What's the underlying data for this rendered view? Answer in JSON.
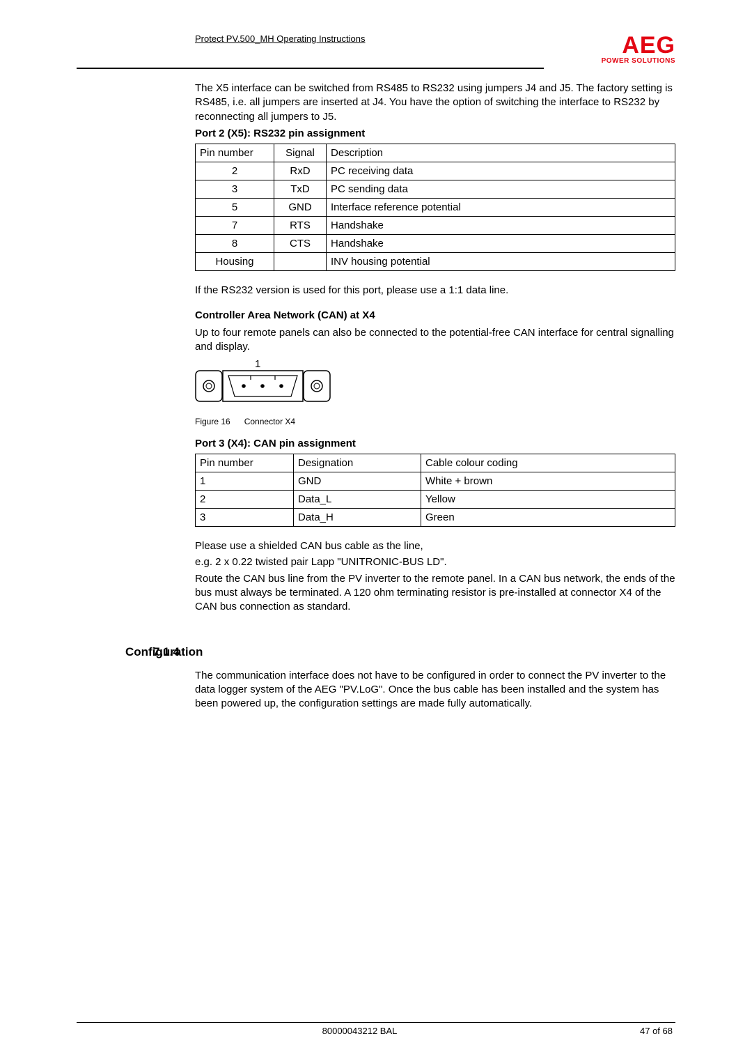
{
  "header": {
    "doc_title": "Protect PV.500_MH Operating Instructions",
    "logo_main": "AEG",
    "logo_sub": "POWER SOLUTIONS"
  },
  "intro_paragraph": "The X5 interface can be switched from RS485 to RS232 using jumpers J4 and J5. The factory setting is RS485, i.e. all jumpers are inserted at J4. You have the option of switching the interface to RS232 by reconnecting all jumpers to J5.",
  "port2": {
    "heading": "Port 2 (X5): RS232 pin assignment",
    "cols": [
      "Pin number",
      "Signal",
      "Description"
    ],
    "rows": [
      {
        "pin": "2",
        "sig": "RxD",
        "desc": "PC receiving data"
      },
      {
        "pin": "3",
        "sig": "TxD",
        "desc": "PC sending data"
      },
      {
        "pin": "5",
        "sig": "GND",
        "desc": "Interface reference potential"
      },
      {
        "pin": "7",
        "sig": "RTS",
        "desc": "Handshake"
      },
      {
        "pin": "8",
        "sig": "CTS",
        "desc": "Handshake"
      },
      {
        "pin": "Housing",
        "sig": "",
        "desc": "INV housing potential"
      }
    ]
  },
  "rs232_note": "If the RS232 version is used for this port, please use a 1:1 data line.",
  "can_section": {
    "heading": "Controller Area Network (CAN) at X4",
    "text": "Up to four remote panels can also be connected to the potential-free CAN interface for central signalling and display."
  },
  "figure": {
    "label_num": "1",
    "caption_prefix": "Figure 16",
    "caption_text": "Connector X4"
  },
  "port3": {
    "heading": "Port 3 (X4): CAN pin assignment",
    "cols": [
      "Pin number",
      "Designation",
      "Cable colour coding"
    ],
    "rows": [
      {
        "pin": "1",
        "des": "GND",
        "col": "White + brown"
      },
      {
        "pin": "2",
        "des": "Data_L",
        "col": "Yellow"
      },
      {
        "pin": "3",
        "des": "Data_H",
        "col": "Green"
      }
    ]
  },
  "shielded_note_1": "Please use a shielded CAN bus cable as the line,",
  "shielded_note_2": "e.g. 2 x 0.22 twisted pair Lapp \"UNITRONIC-BUS LD\".",
  "route_note": "Route the CAN bus line from the PV inverter to the remote panel. In a CAN bus network, the ends of the bus must always be terminated. A 120 ohm terminating resistor is pre-installed at connector X4 of the CAN bus connection as standard.",
  "config": {
    "number": "7.1.4",
    "title": "Configuration",
    "text": "The communication interface does not have to be configured in order to connect the PV inverter to the data logger system of the AEG \"PV.LoG\". Once the bus cable has been installed and the system has been powered up, the configuration settings are made fully automatically."
  },
  "footer": {
    "doc_id": "80000043212 BAL",
    "page": "47 of 68"
  }
}
